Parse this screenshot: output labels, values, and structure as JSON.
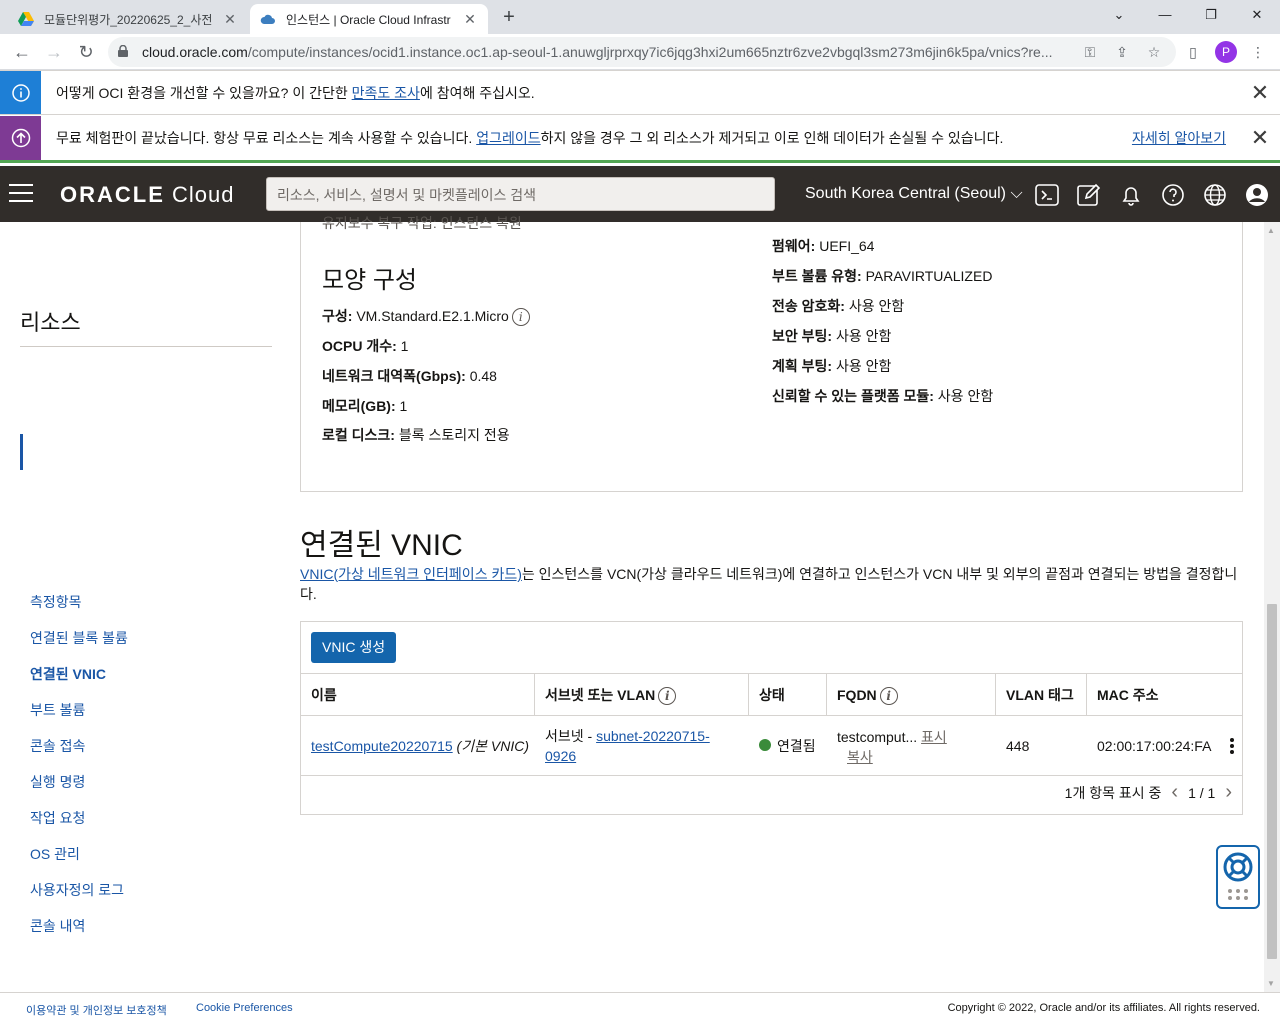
{
  "browser": {
    "tabs": [
      {
        "title": "모듈단위평가_20220625_2_사전",
        "active": false
      },
      {
        "title": "인스턴스 | Oracle Cloud Infrastr",
        "active": true
      }
    ],
    "url_host": "cloud.oracle.com",
    "url_path": "/compute/instances/ocid1.instance.oc1.ap-seoul-1.anuwgljrprxqy7ic6jqg3hxi2um665nztr6zve2vbgql3sm273m6jin6k5pa/vnics?re...",
    "profile_initial": "P"
  },
  "banners": {
    "info": {
      "before": "어떻게 OCI 환경을 개선할 수 있을까요? 이 간단한 ",
      "link": "만족도 조사",
      "after": "에 참여해 주십시오."
    },
    "upgrade": {
      "before": "무료 체험판이 끝났습니다. 항상 무료 리소스는 계속 사용할 수 있습니다. ",
      "link": "업그레이드",
      "after": "하지 않을 경우 그 외 리소스가 제거되고 이로 인해 데이터가 손실될 수 있습니다.",
      "learn_more": "자세히 알아보기"
    }
  },
  "header": {
    "logo_strong": "ORACLE",
    "logo_light": "Cloud",
    "search_placeholder": "리소스, 서비스, 설명서 및 마켓플레이스 검색",
    "region": "South Korea Central (Seoul)"
  },
  "details": {
    "partial_line": "유지보수 복구 작업: 인스턴스 복원",
    "shape_heading": "모양 구성",
    "left": [
      {
        "label": "구성:",
        "value": "VM.Standard.E2.1.Micro",
        "info": true
      },
      {
        "label": "OCPU 개수:",
        "value": "1"
      },
      {
        "label": "네트워크 대역폭(Gbps):",
        "value": "0.48"
      },
      {
        "label": "메모리(GB):",
        "value": "1"
      },
      {
        "label": "로컬 디스크:",
        "value": "블록 스토리지 전용"
      }
    ],
    "right": [
      {
        "label": "펌웨어:",
        "value": "UEFI_64"
      },
      {
        "label": "부트 볼륨 유형:",
        "value": "PARAVIRTUALIZED"
      },
      {
        "label": "전송 암호화:",
        "value": "사용 안함"
      },
      {
        "label": "보안 부팅:",
        "value": "사용 안함"
      },
      {
        "label": "계획 부팅:",
        "value": "사용 안함"
      },
      {
        "label": "신뢰할 수 있는 플랫폼 모듈:",
        "value": "사용 안함"
      }
    ]
  },
  "resources": {
    "title": "리소스",
    "items": [
      "측정항목",
      "연결된 블록 볼륨",
      "연결된 VNIC",
      "부트 볼륨",
      "콘솔 접속",
      "실행 명령",
      "작업 요청",
      "OS 관리",
      "사용자정의 로그",
      "콘솔 내역"
    ],
    "active_index": 2
  },
  "vnic": {
    "title": "연결된 VNIC",
    "desc_link": "VNIC(가상 네트워크 인터페이스 카드)",
    "desc_text": "는 인스턴스를 VCN(가상 클라우드 네트워크)에 연결하고 인스턴스가 VCN 내부 및 외부의 끝점과 연결되는 방법을 결정합니다.",
    "create_button": "VNIC 생성",
    "columns": [
      "이름",
      "서브넷 또는 VLAN",
      "상태",
      "FQDN",
      "VLAN 태그",
      "MAC 주소"
    ],
    "row": {
      "name_link": "testCompute20220715",
      "name_suffix": " (기본 VNIC)",
      "subnet_prefix": "서브넷 - ",
      "subnet_link": "subnet-20220715-0926",
      "status": "연결됨",
      "fqdn": "testcomput...",
      "fqdn_show": "표시",
      "fqdn_copy": "복사",
      "vlan_tag": "448",
      "mac": "02:00:17:00:24:FA"
    },
    "pager_text": "1개 항목 표시 중",
    "page": "1 / 1"
  },
  "footer": {
    "terms": "이용약관 및 개인정보 보호정책",
    "cookie": "Cookie Preferences",
    "copyright": "Copyright © 2022, Oracle and/or its affiliates. All rights reserved."
  },
  "colors": {
    "oracle_header": "#312d2a",
    "link": "#1a56a6",
    "primary_button": "#1465ac",
    "info_banner": "#1e7fd6",
    "upgrade_banner": "#7e3a94",
    "status_green": "#3a8b3a"
  }
}
